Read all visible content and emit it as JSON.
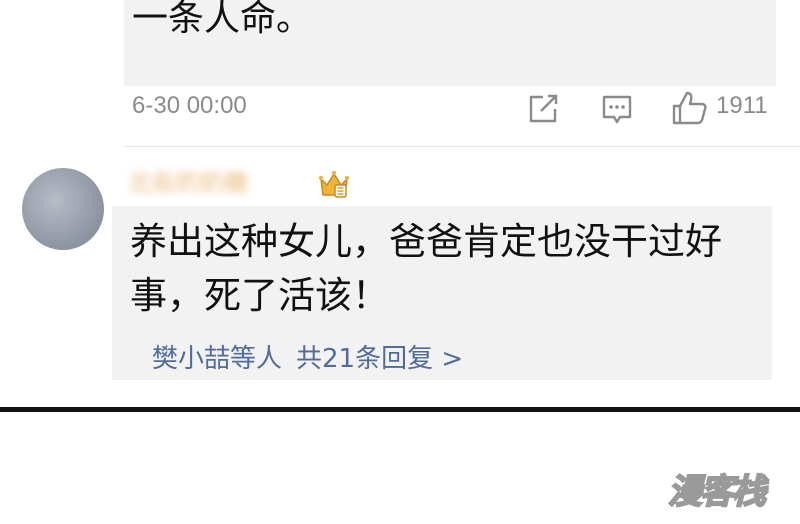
{
  "comment": {
    "text_tail": "一条人命。",
    "timestamp": "6-30 00:00",
    "like_count": "1911",
    "icons": [
      "share-icon",
      "comment-icon",
      "like-icon"
    ]
  },
  "reply": {
    "username": "北街的奶糖",
    "badge_icon": "crown-icon",
    "text": "养出这种女儿，爸爸肯定也没干过好事，死了活该！",
    "repliers": "樊小喆等人",
    "reply_count_link": "共21条回复 >"
  },
  "watermark": "漫客栈",
  "colors": {
    "link": "#506b9c",
    "meta": "#8a8a8a",
    "bubble": "#f2f2f2",
    "crown": "#e2a334"
  }
}
